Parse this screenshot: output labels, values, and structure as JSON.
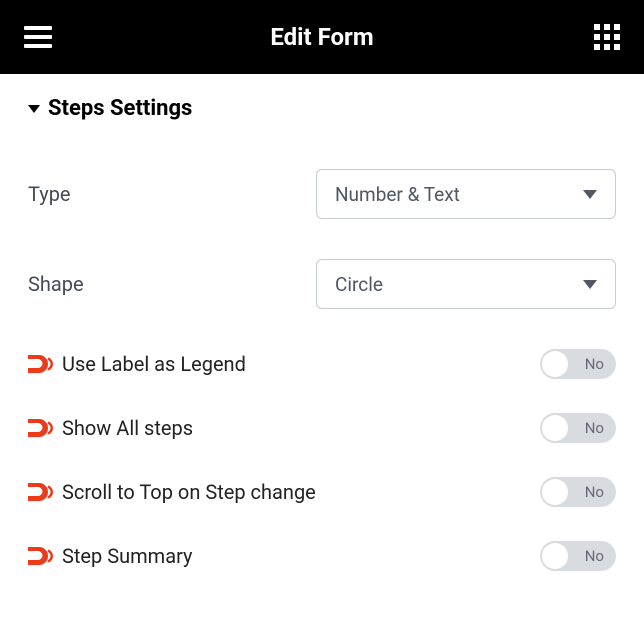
{
  "header": {
    "title": "Edit Form"
  },
  "section": {
    "title": "Steps Settings"
  },
  "fields": {
    "type": {
      "label": "Type",
      "value": "Number & Text"
    },
    "shape": {
      "label": "Shape",
      "value": "Circle"
    }
  },
  "toggles": {
    "useLabelAsLegend": {
      "label": "Use Label as Legend",
      "value": "No"
    },
    "showAllSteps": {
      "label": "Show All steps",
      "value": "No"
    },
    "scrollToTop": {
      "label": "Scroll to Top on Step change",
      "value": "No"
    },
    "stepSummary": {
      "label": "Step Summary",
      "value": "No"
    }
  }
}
